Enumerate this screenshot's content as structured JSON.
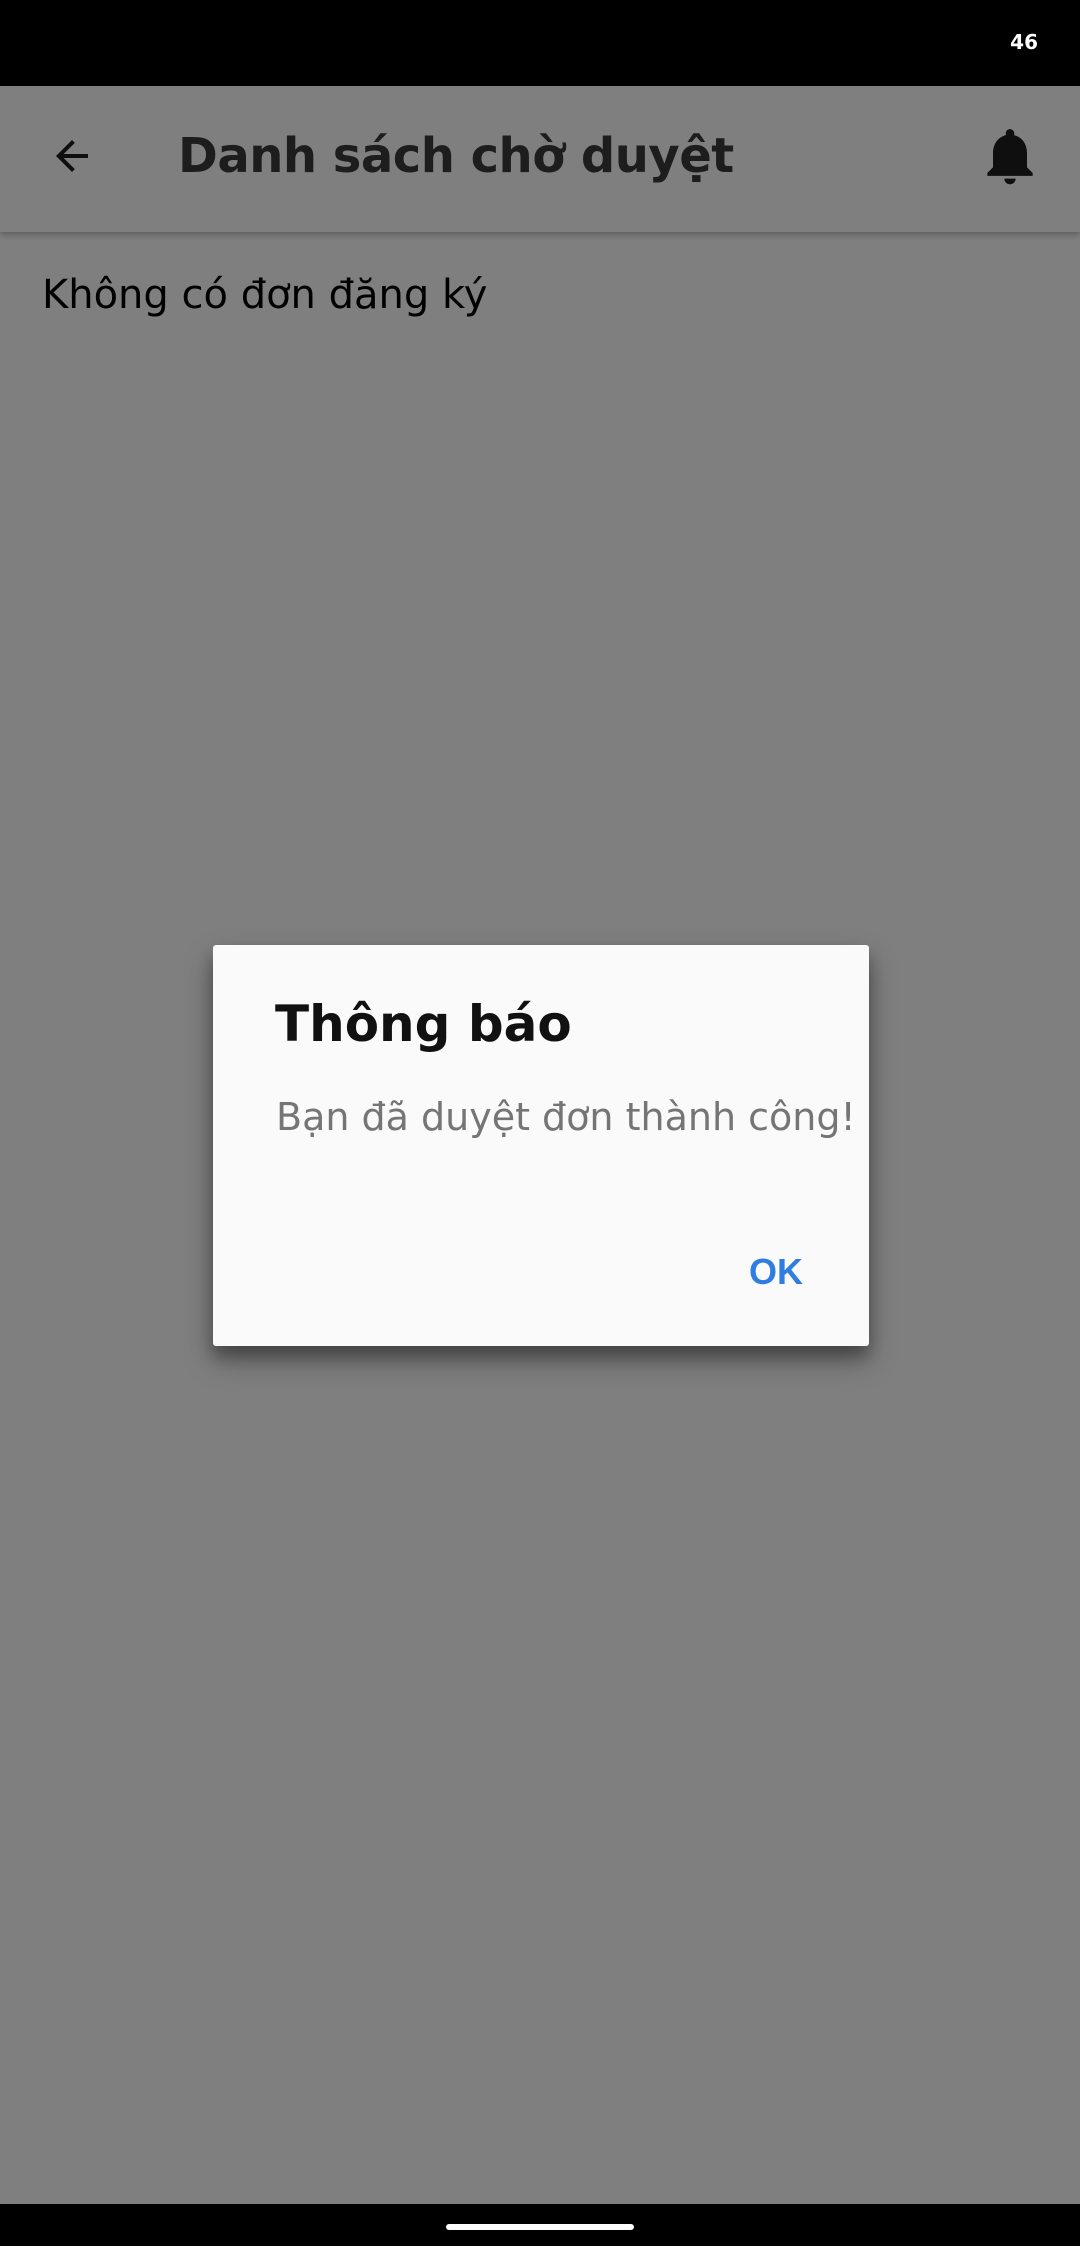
{
  "status_bar": {
    "signal_text": "46"
  },
  "app_bar": {
    "title": "Danh sách chờ duyệt",
    "back_icon": "arrow-left-icon",
    "notification_icon": "bell-icon"
  },
  "content": {
    "empty_message": "Không có đơn đăng ký"
  },
  "dialog": {
    "title": "Thông báo",
    "message": "Bạn đã duyệt đơn thành công!",
    "ok_label": "OK"
  },
  "colors": {
    "accent": "#2f7de1",
    "scrim": "rgba(0,0,0,0.5)"
  }
}
